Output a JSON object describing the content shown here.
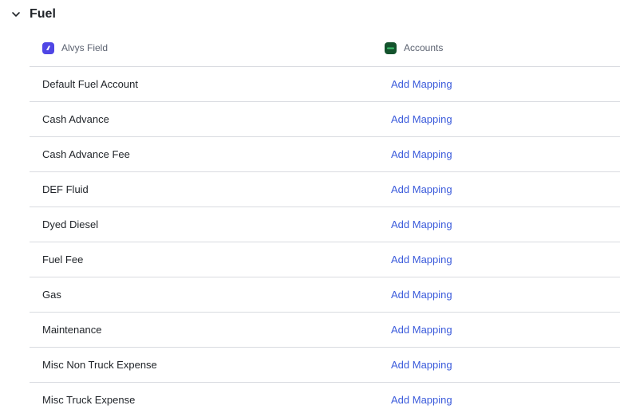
{
  "section": {
    "title": "Fuel"
  },
  "columns": {
    "left": {
      "label": "Alvys Field",
      "icon": "alvys-logo-icon",
      "logo_color": "#4f46e5"
    },
    "right": {
      "label": "Accounts",
      "icon": "quickbooks-logo-icon",
      "logo_color": "#14532d"
    }
  },
  "rows": [
    {
      "field": "Default Fuel Account",
      "action": "Add Mapping"
    },
    {
      "field": "Cash Advance",
      "action": "Add Mapping"
    },
    {
      "field": "Cash Advance Fee",
      "action": "Add Mapping"
    },
    {
      "field": "DEF Fluid",
      "action": "Add Mapping"
    },
    {
      "field": "Dyed Diesel",
      "action": "Add Mapping"
    },
    {
      "field": "Fuel Fee",
      "action": "Add Mapping"
    },
    {
      "field": "Gas",
      "action": "Add Mapping"
    },
    {
      "field": "Maintenance",
      "action": "Add Mapping"
    },
    {
      "field": "Misc Non Truck Expense",
      "action": "Add Mapping"
    },
    {
      "field": "Misc Truck Expense",
      "action": "Add Mapping"
    }
  ],
  "colors": {
    "link": "#3b5bdb",
    "divider": "#d9dbe0"
  }
}
